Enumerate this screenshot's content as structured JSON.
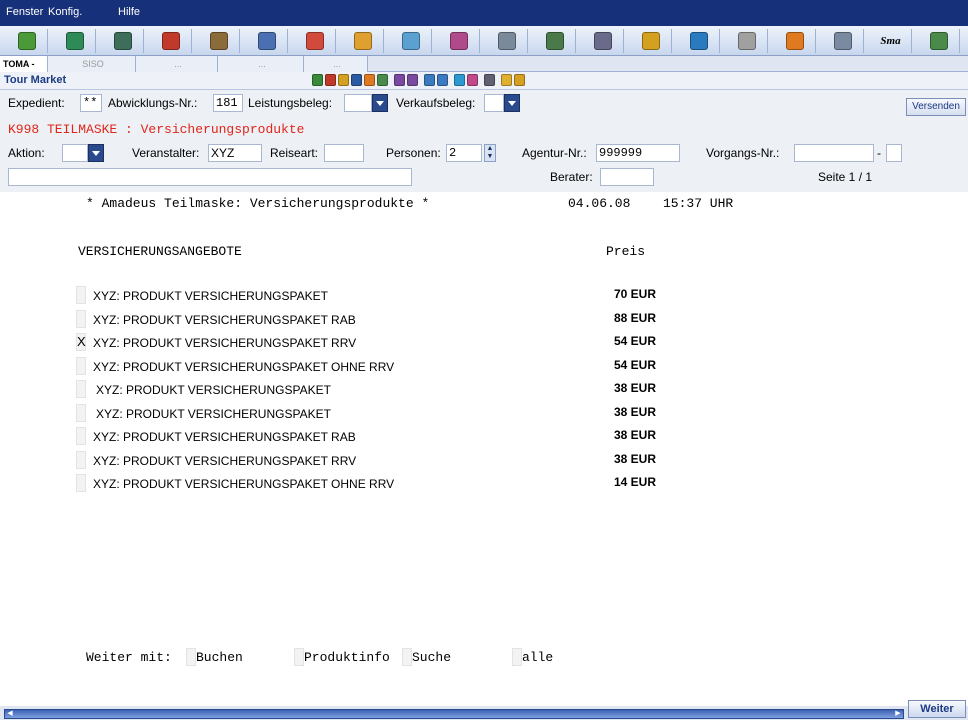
{
  "menubar": {
    "items": [
      "Fenster",
      "Konfig.",
      "Hilfe"
    ]
  },
  "toolbar": {
    "icons": [
      {
        "name": "home-icon",
        "color": "#4a9a3a"
      },
      {
        "name": "calculator-icon",
        "color": "#2e8b57"
      },
      {
        "name": "globe-icon",
        "color": "#3c6e5a"
      },
      {
        "name": "person-icon",
        "color": "#c0392b"
      },
      {
        "name": "palm-tree-icon",
        "color": "#8b6b3a"
      },
      {
        "name": "car-icon",
        "color": "#4b6fb3"
      },
      {
        "name": "traveler-icon",
        "color": "#d14a3b"
      },
      {
        "name": "tools-icon",
        "color": "#e0a030"
      },
      {
        "name": "ship-icon",
        "color": "#5aa0d0"
      },
      {
        "name": "ticket-icon",
        "color": "#b04a8a"
      },
      {
        "name": "document-icon",
        "color": "#7a8a9a"
      },
      {
        "name": "notes-icon",
        "color": "#4a7a4a"
      },
      {
        "name": "settings-icon",
        "color": "#6a6a8a"
      },
      {
        "name": "pencil-icon",
        "color": "#d4a020"
      },
      {
        "name": "info-icon",
        "color": "#2a7ac0"
      },
      {
        "name": "figure-icon",
        "color": "#a0a0a0"
      },
      {
        "name": "chart-icon",
        "color": "#e07a20"
      },
      {
        "name": "window-icon",
        "color": "#7a8aa0"
      },
      {
        "name": "sma-icon",
        "color": "#000000"
      },
      {
        "name": "exit-icon",
        "color": "#4a8a4a"
      }
    ],
    "sma_label": "Sma"
  },
  "tabs": {
    "active": "TOMA - XYZ",
    "close": "×",
    "inactive": [
      "SISO",
      "...",
      "...",
      "..."
    ]
  },
  "tourmarket": {
    "title": "Tour Market"
  },
  "form": {
    "expedient_label": "Expedient:",
    "expedient_value": "**",
    "abwicklung_label": "Abwicklungs-Nr.:",
    "abwicklung_value": "181",
    "leistungsbeleg_label": "Leistungsbeleg:",
    "verkaufsbeleg_label": "Verkaufsbeleg:",
    "versenden_label": "Versenden",
    "red_title": "K998 TEILMASKE : Versicherungsprodukte",
    "aktion_label": "Aktion:",
    "veranstalter_label": "Veranstalter:",
    "veranstalter_value": "XYZ",
    "reiseart_label": "Reiseart:",
    "personen_label": "Personen:",
    "personen_value": "2",
    "agentur_label": "Agentur-Nr.:",
    "agentur_value": "999999",
    "vorgangs_label": "Vorgangs-Nr.:",
    "vorgangs_sep": "-",
    "berater_label": "Berater:",
    "seite_label": "Seite 1 / 1"
  },
  "main": {
    "header_title": "* Amadeus Teilmaske: Versicherungsprodukte *",
    "date": "04.06.08",
    "time": "15:37 UHR",
    "section_label": "VERSICHERUNGSANGEBOTE",
    "price_header": "Preis",
    "offers": [
      {
        "mark": "",
        "name": "XYZ: PRODUKT VERSICHERUNGSPAKET",
        "price": "70 EUR"
      },
      {
        "mark": "",
        "name": "XYZ: PRODUKT VERSICHERUNGSPAKET RAB",
        "price": "88 EUR"
      },
      {
        "mark": "X",
        "name": "XYZ: PRODUKT VERSICHERUNGSPAKET RRV",
        "price": "54 EUR"
      },
      {
        "mark": "",
        "name": "XYZ: PRODUKT VERSICHERUNGSPAKET OHNE RRV",
        "price": "54 EUR"
      },
      {
        "mark": "",
        "name": "XYZ: PRODUKT VERSICHERUNGSPAKET",
        "price": "38 EUR"
      },
      {
        "mark": "",
        "name": "XYZ: PRODUKT VERSICHERUNGSPAKET",
        "price": "38 EUR"
      },
      {
        "mark": "",
        "name": "XYZ: PRODUKT VERSICHERUNGSPAKET RAB",
        "price": "38 EUR"
      },
      {
        "mark": "",
        "name": "XYZ: PRODUKT VERSICHERUNGSPAKET RRV",
        "price": "38 EUR"
      },
      {
        "mark": "",
        "name": "XYZ: PRODUKT VERSICHERUNGSPAKET OHNE RRV",
        "price": "14 EUR"
      }
    ],
    "footer": {
      "weiter_mit": "Weiter mit:",
      "buchen": "Buchen",
      "produktinfo": "Produktinfo",
      "suche": "Suche",
      "alle": "alle"
    }
  },
  "bottom": {
    "weiter_button": "Weiter"
  }
}
